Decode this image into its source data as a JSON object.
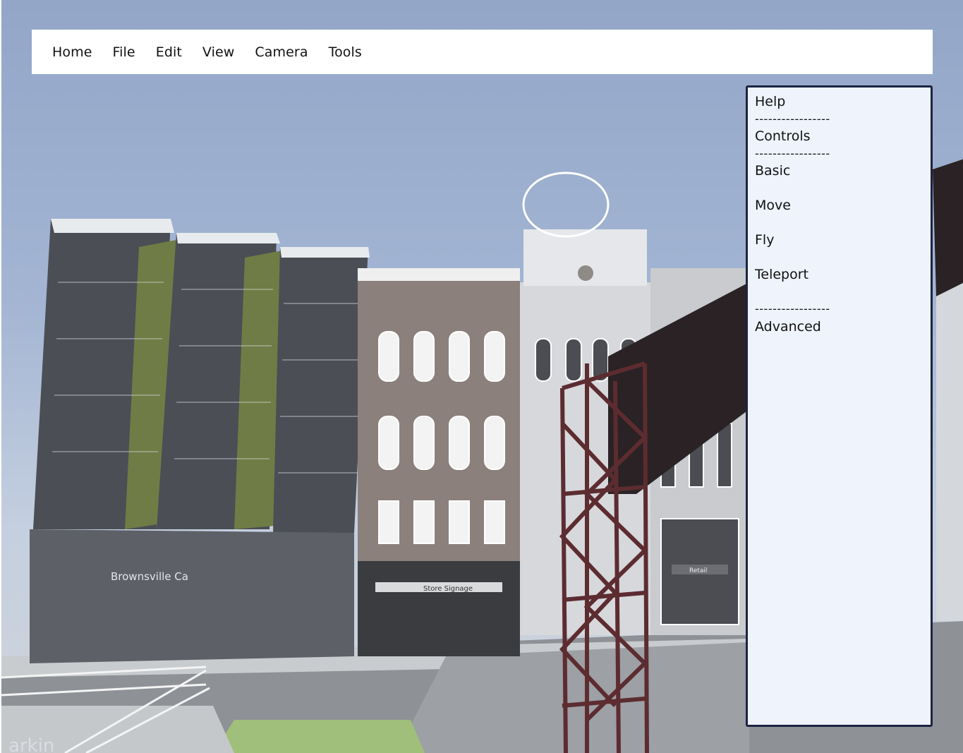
{
  "menubar": {
    "items": [
      "Home",
      "File",
      "Edit",
      "View",
      "Camera",
      "Tools"
    ]
  },
  "help_panel": {
    "title": "Help",
    "separator": "-----------------",
    "section_controls": "Controls",
    "items": [
      "Basic",
      "Move",
      "Fly",
      "Teleport"
    ],
    "section_advanced": "Advanced"
  },
  "scene": {
    "signs": {
      "left_building": "Brownsville Ca",
      "store": "Store Signage",
      "retail": "Retail",
      "ground": "arkin"
    }
  },
  "colors": {
    "sky": "#93a6c8",
    "panel_bg": "#eef3fc",
    "panel_border": "#1d2442",
    "menubar_bg": "#ffffff"
  }
}
